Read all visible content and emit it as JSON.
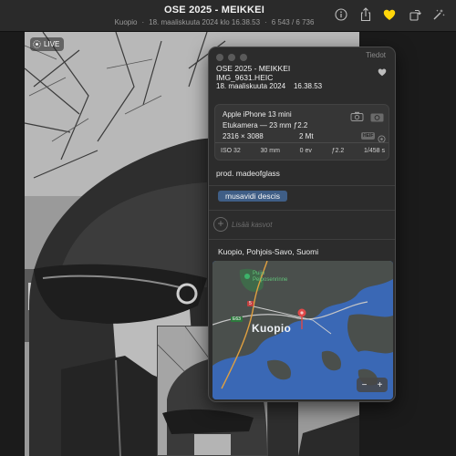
{
  "toolbar": {
    "title": "OSE 2025 - MEIKKEI",
    "location": "Kuopio",
    "datetime": "18. maaliskuuta 2024 klo 16.38.53",
    "counter": "6 543 / 6 736",
    "icons": [
      "info-icon",
      "share-icon",
      "favorite-heart-icon",
      "rotate-icon",
      "magic-wand-icon"
    ],
    "favorite_color": "#ffd60a"
  },
  "photo": {
    "live_label": "LIVE"
  },
  "panel": {
    "title": "Tiedot",
    "album_name": "OSE 2025 - MEIKKEI",
    "file_name": "IMG_9631.HEIC",
    "date": "18. maaliskuuta 2024",
    "time": "16.38.53",
    "camera": {
      "device": "Apple iPhone 13 mini",
      "lens": "Etukamera — 23 mm ƒ2.2",
      "resolution": "2316 × 3088",
      "megapixels": "2 Mt",
      "format_badge": "HEIF",
      "exif": [
        "ISO 32",
        "30 mm",
        "0 ev",
        "ƒ2.2",
        "1/458 s"
      ]
    },
    "caption": "prod. madeofglass",
    "keyword": "musavidi descis",
    "add_faces": "Lisää kasvot",
    "location": "Kuopio, Pohjois-Savo, Suomi",
    "map": {
      "place_label": "Kuopio",
      "poi_label_1": "Puijo",
      "poi_label_2": "Peiposenrinne",
      "road_5": "5",
      "road_e63": "E63",
      "zoom_minus": "−",
      "zoom_plus": "+",
      "water_color": "#3a68b5",
      "land_color": "#4a4f4c"
    }
  }
}
